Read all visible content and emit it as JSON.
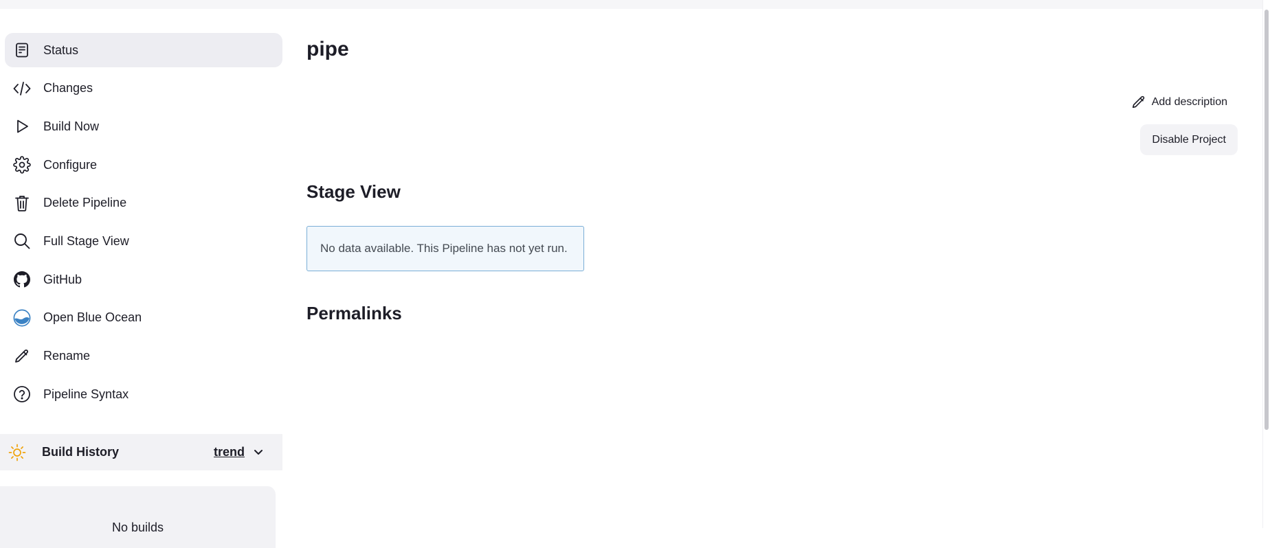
{
  "sidebar": {
    "items": [
      {
        "label": "Status",
        "icon": "status-document-icon",
        "active": true
      },
      {
        "label": "Changes",
        "icon": "code-icon"
      },
      {
        "label": "Build Now",
        "icon": "play-icon"
      },
      {
        "label": "Configure",
        "icon": "gear-icon"
      },
      {
        "label": "Delete Pipeline",
        "icon": "trash-icon"
      },
      {
        "label": "Full Stage View",
        "icon": "search-icon"
      },
      {
        "label": "GitHub",
        "icon": "github-icon"
      },
      {
        "label": "Open Blue Ocean",
        "icon": "blue-ocean-icon"
      },
      {
        "label": "Rename",
        "icon": "pencil-icon"
      },
      {
        "label": "Pipeline Syntax",
        "icon": "help-icon"
      }
    ]
  },
  "build_history": {
    "title": "Build History",
    "trend_label": "trend",
    "empty_text": "No builds",
    "icon": "sun-icon"
  },
  "main": {
    "title": "pipe",
    "add_description": "Add description",
    "disable_project": "Disable Project",
    "stage_view_heading": "Stage View",
    "stage_view_notice": "No data available. This Pipeline has not yet run.",
    "permalinks_heading": "Permalinks"
  },
  "colors": {
    "accent_blue": "#3b82c4",
    "sun_orange": "#f0a30a",
    "active_bg": "#ededf2"
  }
}
